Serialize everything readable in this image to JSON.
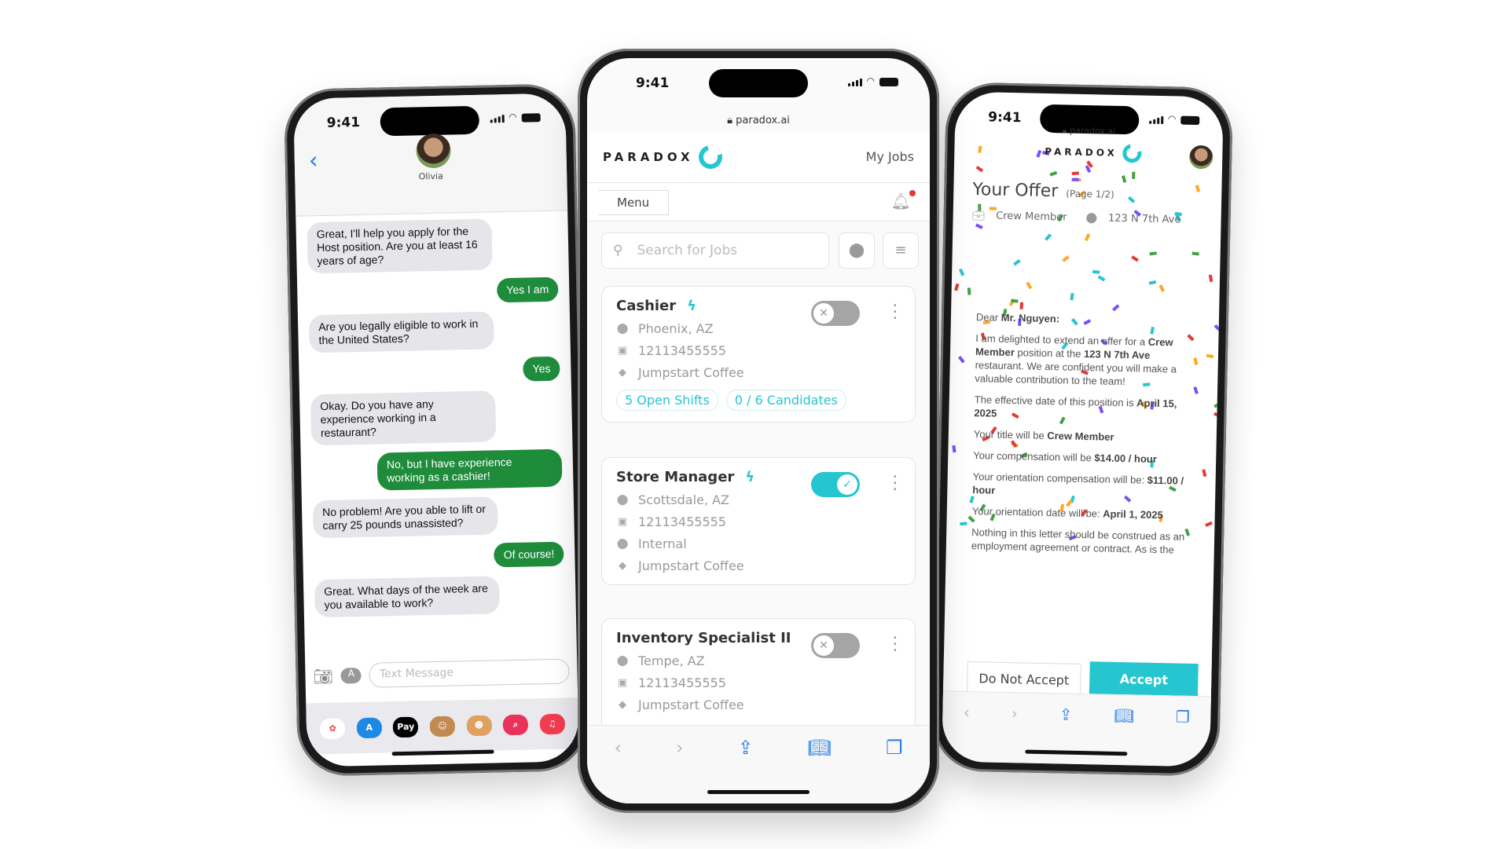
{
  "colors": {
    "accent": "#26c6d0",
    "imessage_green": "#1f8c3c",
    "link_blue": "#2b7de9",
    "notification": "#e53935"
  },
  "status_time": "9:41",
  "messages_phone": {
    "contact_name": "Olivia",
    "back_icon": "chevron-left-icon",
    "messages": [
      {
        "from": "in",
        "text": "Great, I'll help you apply for the Host position. Are you at least 16 years of age?"
      },
      {
        "from": "out",
        "text": "Yes I am"
      },
      {
        "from": "in",
        "text": "Are you legally eligible to work in the United States?"
      },
      {
        "from": "out",
        "text": "Yes"
      },
      {
        "from": "in",
        "text": "Okay. Do you have any experience working in a restaurant?"
      },
      {
        "from": "out",
        "text": "No, but I have experience working as a cashier!"
      },
      {
        "from": "in",
        "text": "No problem! Are you able to lift or carry 25 pounds unassisted?"
      },
      {
        "from": "out",
        "text": "Of course!"
      },
      {
        "from": "in",
        "text": "Great. What days of the week are you available to work?"
      }
    ],
    "input_placeholder": "Text Message",
    "app_strip": [
      "Photos",
      "App Store",
      "Pay",
      "Memoji",
      "Stickers",
      "Search",
      "Music"
    ]
  },
  "jobs_phone": {
    "url": "paradox.ai",
    "brand": "PARADOX",
    "my_jobs": "My Jobs",
    "menu": "Menu",
    "search_placeholder": "Search for Jobs",
    "jobs": [
      {
        "title": "Cashier",
        "location": "Phoenix, AZ",
        "id": "12113455555",
        "company": "Jumpstart Coffee",
        "active": false,
        "open_shifts": "5 Open Shifts",
        "candidates": "0 / 6 Candidates"
      },
      {
        "title": "Store Manager",
        "location": "Scottsdale, AZ",
        "id": "12113455555",
        "type": "Internal",
        "company": "Jumpstart Coffee",
        "active": true
      },
      {
        "title": "Inventory Specialist II",
        "location": "Tempe, AZ",
        "id": "12113455555",
        "company": "Jumpstart Coffee",
        "active": false
      }
    ]
  },
  "offer_phone": {
    "url": "paradox.ai",
    "brand": "PARADOX",
    "title": "Your Offer",
    "page": "(Page 1/2)",
    "role": "Crew Member",
    "address": "123 N 7th Ave",
    "salutation_pre": "Dear ",
    "salutation_name": "Mr. Nguyen:",
    "p1_a": "I am delighted to extend an offer for a ",
    "p1_role": "Crew Member",
    "p1_b": " position at the ",
    "p1_addr": "123 N 7th Ave",
    "p1_c": " restaurant.  We are confident you will make a valuable contribution to the team!",
    "p2_a": "The effective date of this position is ",
    "p2_date": "April 15, 2025",
    "p3_a": "Your title will be ",
    "p3_role": "Crew Member",
    "p4_a": "Your compensation will be ",
    "p4_val": "$14.00 / hour",
    "p5_a": "Your orientation compensation will be: ",
    "p5_val": "$11.00 / hour",
    "p6_a": "Your orientation date will be: ",
    "p6_val": "April 1, 2025",
    "p7": "Nothing in this letter should be construed as an employment agreement or contract.  As is the",
    "decline": "Do Not Accept",
    "accept": "Accept"
  }
}
